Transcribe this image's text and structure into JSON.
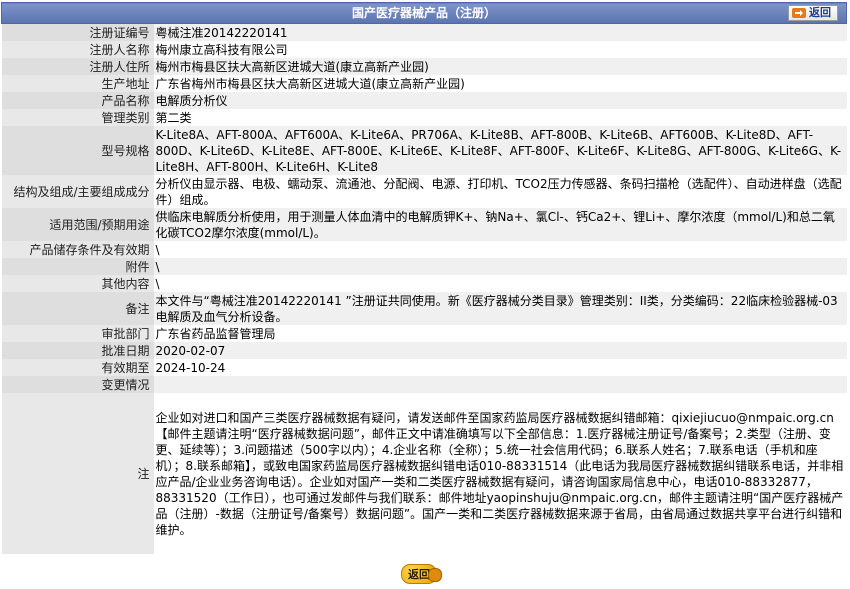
{
  "header": {
    "title": "国产医疗器械产品（注册）",
    "back_label": "返回"
  },
  "rows": [
    {
      "label": "注册证编号",
      "value": "粤械注准20142220141"
    },
    {
      "label": "注册人名称",
      "value": "梅州康立高科技有限公司"
    },
    {
      "label": "注册人住所",
      "value": "梅州市梅县区扶大高新区进城大道(康立高新产业园)"
    },
    {
      "label": "生产地址",
      "value": "广东省梅州市梅县区扶大高新区进城大道(康立高新产业园)"
    },
    {
      "label": "产品名称",
      "value": "电解质分析仪"
    },
    {
      "label": "管理类别",
      "value": "第二类"
    },
    {
      "label": "型号规格",
      "value": "K-Lite8A、AFT-800A、AFT600A、K-Lite6A、PR706A、K-Lite8B、AFT-800B、K-Lite6B、AFT600B、K-Lite8D、AFT-800D、K-Lite6D、K-Lite8E、AFT-800E、K-Lite6E、K-Lite8F、AFT-800F、K-Lite6F、K-Lite8G、AFT-800G、K-Lite6G、K-Lite8H、AFT-800H、K-Lite6H、K-Lite8"
    },
    {
      "label": "结构及组成/主要组成成分",
      "value": "分析仪由显示器、电极、蠕动泵、流通池、分配阀、电源、打印机、TCO2压力传感器、条码扫描枪（选配件）、自动进样盘（选配件）组成。"
    },
    {
      "label": "适用范围/预期用途",
      "value": "供临床电解质分析使用，用于测量人体血清中的电解质钾K+、钠Na+、氯Cl-、钙Ca2+、锂Li+、摩尔浓度（mmol/L)和总二氧化碳TCO2摩尔浓度(mmol/L)。"
    },
    {
      "label": "产品储存条件及有效期",
      "value": "\\"
    },
    {
      "label": "附件",
      "value": "\\"
    },
    {
      "label": "其他内容",
      "value": "\\"
    },
    {
      "label": "备注",
      "value": "本文件与“粤械注准20142220141 ”注册证共同使用。新《医疗器械分类目录》管理类别：II类，分类编码：22临床检验器械-03电解质及血气分析设备。"
    },
    {
      "label": "审批部门",
      "value": "广东省药品监督管理局"
    },
    {
      "label": "批准日期",
      "value": "2020-02-07"
    },
    {
      "label": "有效期至",
      "value": "2024-10-24"
    },
    {
      "label": "变更情况",
      "value": ""
    }
  ],
  "note": {
    "label": "注",
    "value": "企业如对进口和国产三类医疗器械数据有疑问，请发送邮件至国家药监局医疗器械数据纠错邮箱：qixiejiucuo@nmpaic.org.cn【邮件主题请注明“医疗器械数据问题”，邮件正文中请准确填写以下全部信息：1.医疗器械注册证号/备案号；2.类型（注册、变更、延续等）；3.问题描述（500字以内）；4.企业名称（全称）；5.统一社会信用代码；6.联系人姓名；7.联系电话（手机和座机）；8.联系邮箱】，或致电国家药监局医疗器械数据纠错电话010-88331514（此电话为我局医疗器械数据纠错联系电话，并非相应产品/企业业务咨询电话）。企业如对国产一类和二类医疗器械数据有疑问，请咨询国家局信息中心，电话010-88332877，88331520（工作日），也可通过发邮件与我们联系：邮件地址yaopinshuju@nmpaic.org.cn，邮件主题请注明“国产医疗器械产品（注册）-数据（注册证号/备案号）数据问题”。国产一类和二类医疗器械数据来源于省局，由省局通过数据共享平台进行纠错和维护。"
  },
  "footer": {
    "back_label": "返回"
  },
  "colors": {
    "header_bg": "#6a82bd",
    "label_bg": "#e8e8e8",
    "accent_orange": "#e47a1a"
  }
}
